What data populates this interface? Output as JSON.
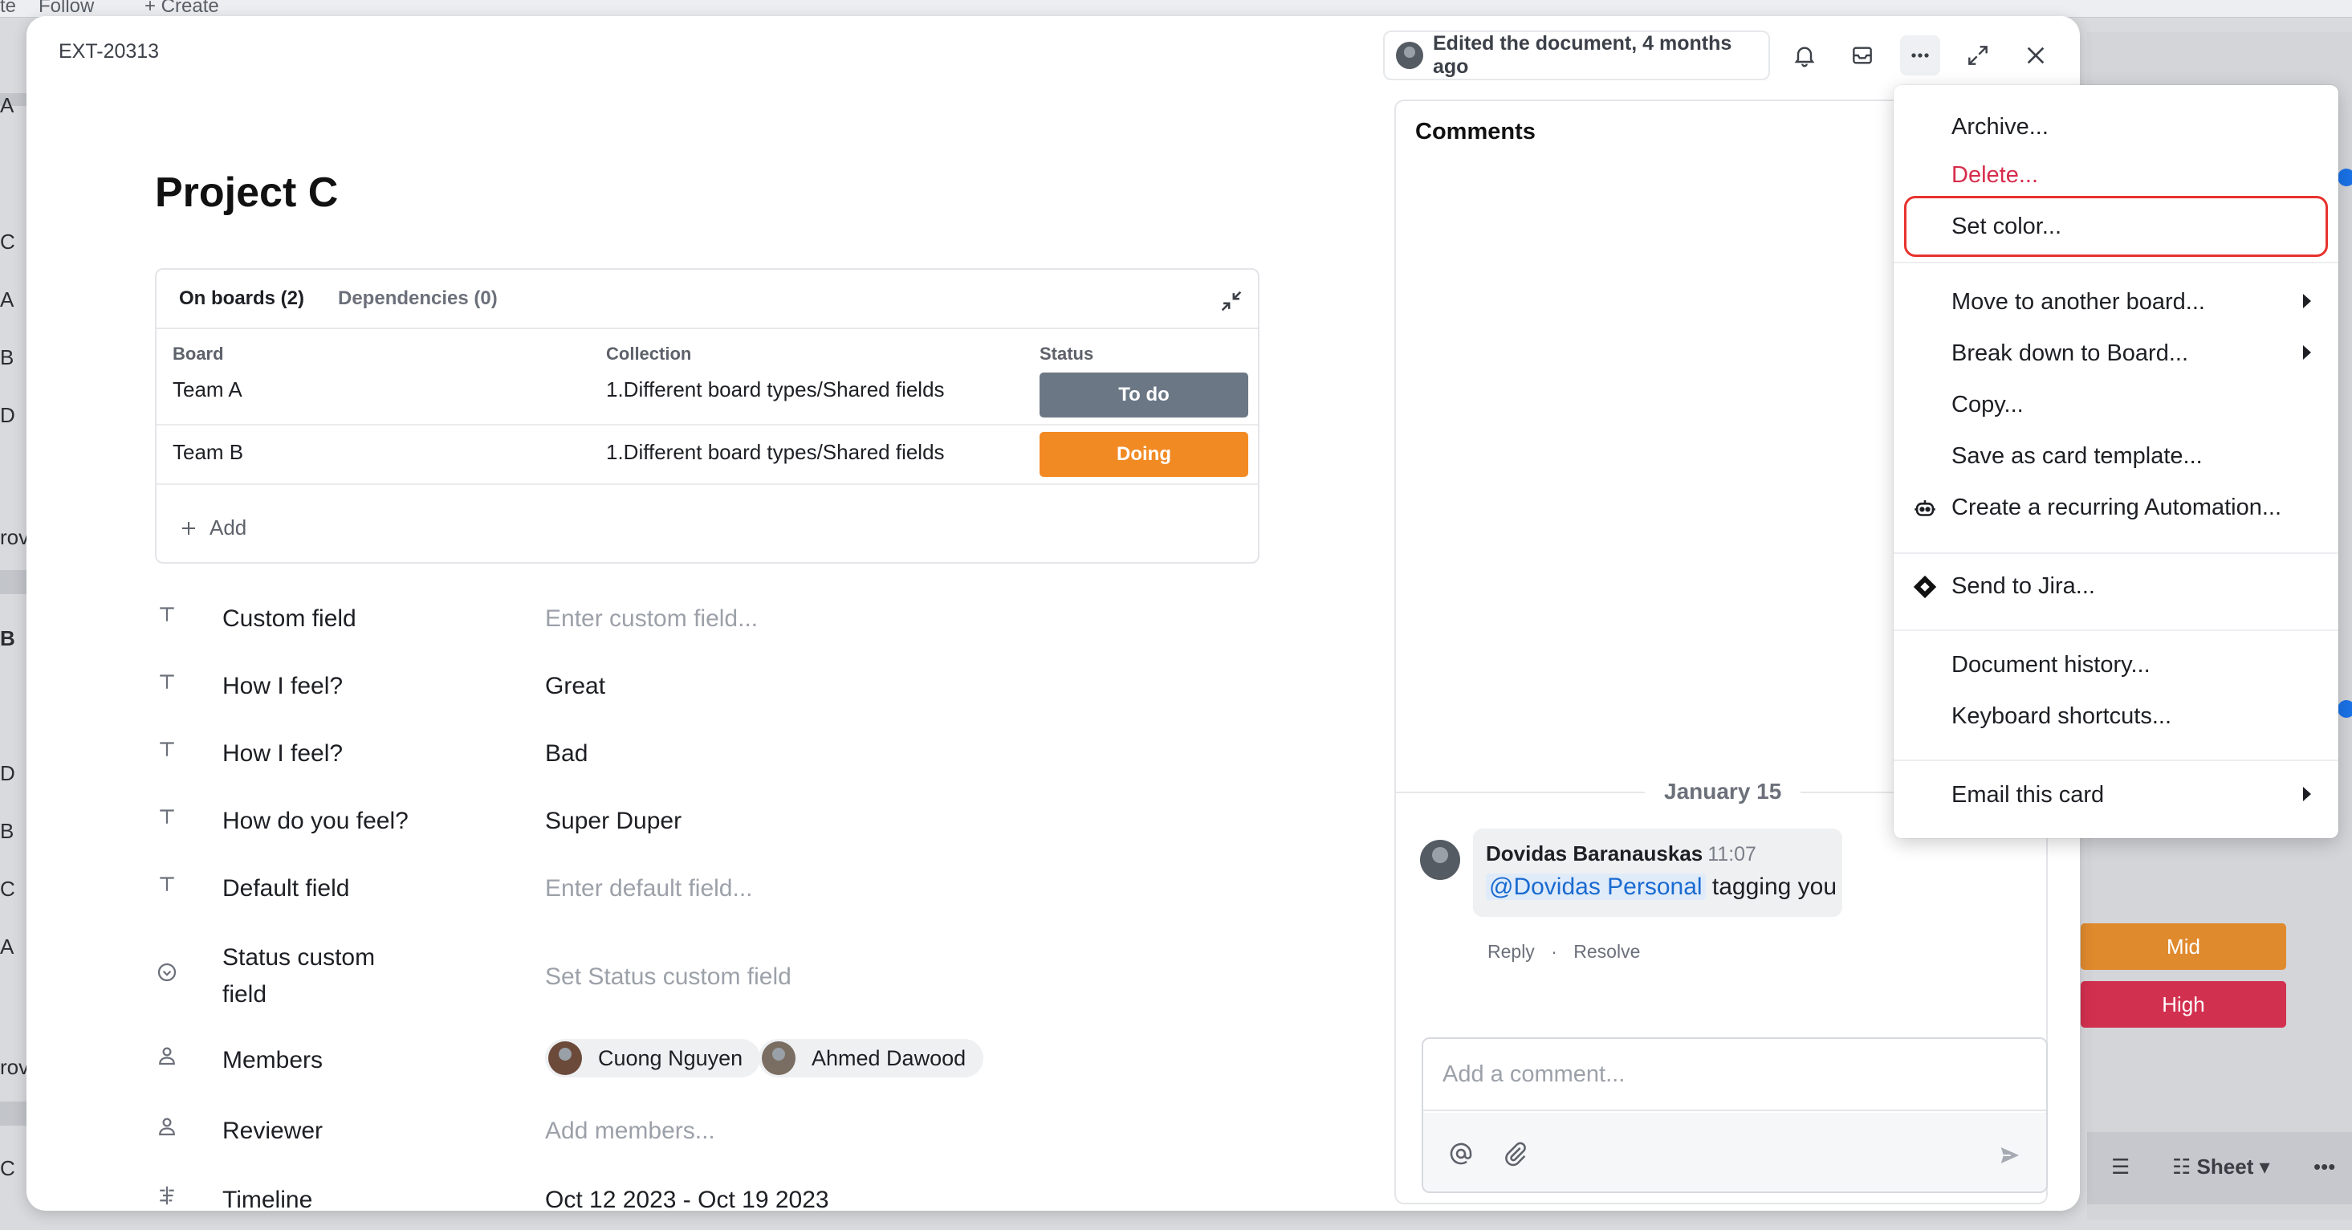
{
  "background": {
    "top_items": [
      "te",
      "Follow",
      "+ Create"
    ],
    "left_letters": [
      "A",
      "C",
      "A",
      "B",
      "D",
      "rov",
      "B",
      "D",
      "B",
      "C",
      "A",
      "rov",
      "C"
    ],
    "right_pills": [
      {
        "label": "Mid",
        "color": "#e08a2e"
      },
      {
        "label": "High",
        "color": "#d2304f"
      }
    ],
    "bottom_toolbar": {
      "view_label": "Sheet"
    }
  },
  "card": {
    "id": "EXT-20313",
    "edited_label": "Edited the document, 4 months ago",
    "title": "Project C",
    "toolbar_icons": [
      "bell-icon",
      "inbox-icon",
      "more-icon",
      "expand-icon",
      "close-icon"
    ]
  },
  "boards_panel": {
    "tabs": [
      {
        "label": "On boards (2)",
        "active": true
      },
      {
        "label": "Dependencies (0)",
        "active": false
      }
    ],
    "columns": [
      "Board",
      "Collection",
      "Status"
    ],
    "rows": [
      {
        "board": "Team A",
        "collection": "1.Different board types/Shared fields",
        "status": "To do",
        "status_color": "#6b7785"
      },
      {
        "board": "Team B",
        "collection": "1.Different board types/Shared fields",
        "status": "Doing",
        "status_color": "#f28a24"
      }
    ],
    "add_label": "Add"
  },
  "fields": [
    {
      "icon": "text-icon",
      "label": "Custom field",
      "value": "Enter custom field...",
      "placeholder": true
    },
    {
      "icon": "text-icon",
      "label": "How I feel?",
      "value": "Great",
      "placeholder": false
    },
    {
      "icon": "text-icon",
      "label": "How I feel?",
      "value": "Bad",
      "placeholder": false
    },
    {
      "icon": "text-icon",
      "label": "How do you feel?",
      "value": "Super Duper",
      "placeholder": false
    },
    {
      "icon": "text-icon",
      "label": "Default field",
      "value": "Enter default field...",
      "placeholder": true
    },
    {
      "icon": "status-icon",
      "label_line1": "Status custom",
      "label_line2": "field",
      "value": "Set Status custom field",
      "placeholder": true
    },
    {
      "icon": "person-icon",
      "label": "Members",
      "members": [
        "Cuong Nguyen",
        "Ahmed Dawood"
      ]
    },
    {
      "icon": "person-icon",
      "label": "Reviewer",
      "value": "Add members...",
      "placeholder": true
    },
    {
      "icon": "timeline-icon",
      "label": "Timeline",
      "start": "Oct 12 2023",
      "separator": " - ",
      "end": "Oct 19 2023",
      "color": "#d72c4b"
    }
  ],
  "comments": {
    "heading": "Comments",
    "date": "January 15",
    "items": [
      {
        "author": "Dovidas Baranauskas",
        "time": "11:07",
        "mention": "@Dovidas Personal",
        "text": " tagging you",
        "actions": [
          "Reply",
          "·",
          "Resolve"
        ]
      }
    ],
    "input_placeholder": "Add a comment..."
  },
  "menu": {
    "items": [
      {
        "label": "Archive..."
      },
      {
        "label": "Delete...",
        "danger": true
      },
      {
        "label": "Set color...",
        "highlighted": true
      },
      {
        "label": "Move to another board...",
        "submenu": true
      },
      {
        "label": "Break down to Board...",
        "submenu": true
      },
      {
        "label": "Copy..."
      },
      {
        "label": "Save as card template..."
      },
      {
        "label": "Create a recurring Automation...",
        "icon": "robot-icon"
      },
      {
        "label": "Send to Jira...",
        "icon": "jira-icon"
      },
      {
        "label": "Document history..."
      },
      {
        "label": "Keyboard shortcuts..."
      },
      {
        "label": "Email this card",
        "submenu": true
      }
    ]
  }
}
